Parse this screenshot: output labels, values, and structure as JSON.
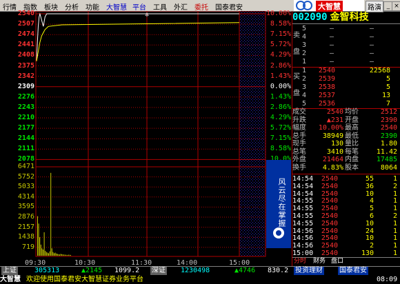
{
  "menu": {
    "items": [
      "行情",
      "指数",
      "板块",
      "分析",
      "功能",
      "大智慧",
      "平台",
      "工具",
      "外汇",
      "委托",
      "国泰君安"
    ],
    "right_button": "路演",
    "logo_text": "大智慧"
  },
  "stock": {
    "code": "002090",
    "name": "金智科技"
  },
  "price_axis": {
    "labels": [
      "2540",
      "2507",
      "2474",
      "2441",
      "2408",
      "2375",
      "2342",
      "2309",
      "2276",
      "2243",
      "2210",
      "2177",
      "2144",
      "2111",
      "2078"
    ],
    "percents": [
      "10.00%",
      "8.58%",
      "7.15%",
      "5.72%",
      "4.29%",
      "2.86%",
      "1.43%",
      "0.00%",
      "1.43%",
      "2.86%",
      "4.29%",
      "5.72%",
      "7.15%",
      "8.58%",
      "10.0%"
    ]
  },
  "volume_axis": {
    "labels": [
      "6471",
      "5752",
      "5033",
      "4314",
      "3595",
      "2876",
      "2157",
      "1438",
      "719"
    ]
  },
  "time_axis": {
    "labels": [
      "09:30",
      "10:30",
      "11:30",
      "14:00",
      "15:00"
    ]
  },
  "side_banner": "风云尽在掌握",
  "order_book": {
    "sell_label": [
      "卖",
      "盘"
    ],
    "buy_label": [
      "买",
      "盘"
    ],
    "sells": [
      {
        "level": "5",
        "price": "—",
        "vol": "—"
      },
      {
        "level": "4",
        "price": "—",
        "vol": "—"
      },
      {
        "level": "3",
        "price": "—",
        "vol": "—"
      },
      {
        "level": "2",
        "price": "—",
        "vol": "—"
      },
      {
        "level": "1",
        "price": "—",
        "vol": "—"
      }
    ],
    "buys": [
      {
        "level": "1",
        "price": "2540",
        "vol": "22568"
      },
      {
        "level": "2",
        "price": "2539",
        "vol": "5"
      },
      {
        "level": "3",
        "price": "2538",
        "vol": "5"
      },
      {
        "level": "4",
        "price": "2537",
        "vol": "13"
      },
      {
        "level": "5",
        "price": "2536",
        "vol": "7"
      }
    ]
  },
  "stats": [
    {
      "l1": "成交",
      "v1": "2540",
      "l2": "均价",
      "v2": "2512"
    },
    {
      "l1": "升跌",
      "v1": "▲231",
      "l2": "开盘",
      "v2": "2390"
    },
    {
      "l1": "幅度",
      "v1": "10.00%",
      "l2": "最高",
      "v2": "2540"
    },
    {
      "l1": "总手",
      "v1": "38949",
      "l2": "最低",
      "v2": "2390"
    },
    {
      "l1": "现手",
      "v1": "130",
      "l2": "量比",
      "v2": "1.80"
    },
    {
      "l1": "总笔",
      "v1": "3410",
      "l2": "每笔",
      "v2": "11.42"
    },
    {
      "l1": "外盘",
      "v1": "21464",
      "l2": "内盘",
      "v2": "17485"
    },
    {
      "l1": "换手",
      "v1": "4.83%",
      "l2": "股本",
      "v2": "8064"
    }
  ],
  "ticks": [
    {
      "time": "14:54",
      "price": "2540",
      "vol": "55",
      "cnt": "1"
    },
    {
      "time": "14:54",
      "price": "2540",
      "vol": "36",
      "cnt": "2"
    },
    {
      "time": "14:54",
      "price": "2540",
      "vol": "10",
      "cnt": "1"
    },
    {
      "time": "14:55",
      "price": "2540",
      "vol": "4",
      "cnt": "1"
    },
    {
      "time": "14:55",
      "price": "2540",
      "vol": "5",
      "cnt": "1"
    },
    {
      "time": "14:55",
      "price": "2540",
      "vol": "6",
      "cnt": "2"
    },
    {
      "time": "14:55",
      "price": "2540",
      "vol": "10",
      "cnt": "1"
    },
    {
      "time": "14:56",
      "price": "2540",
      "vol": "24",
      "cnt": "1"
    },
    {
      "time": "14:56",
      "price": "2540",
      "vol": "10",
      "cnt": "1"
    },
    {
      "time": "14:56",
      "price": "2540",
      "vol": "2",
      "cnt": "1"
    },
    {
      "time": "15:00",
      "price": "2540",
      "vol": "130",
      "cnt": "1"
    }
  ],
  "tabs": [
    "分时",
    "财务",
    "盘口"
  ],
  "bottom": {
    "sh_label": "上证",
    "sh_vol": "305313",
    "sh_chg": "▲2145",
    "sh_idx": "1099.2",
    "sz_label": "深证",
    "sz_vol": "1230498",
    "sz_chg": "▲4746",
    "sz_idx": "830.2",
    "promo1": "投资理财",
    "promo2": "国泰君安"
  },
  "ticker": {
    "brand": "大智慧",
    "text": "欢迎使用国泰君安大智慧证券业务平台",
    "clock": "08:09"
  },
  "colors": {
    "up": "#ff3232",
    "down": "#00e600",
    "grid": "#b00000",
    "price_line": "#ffffff",
    "avg_line": "#ffff00"
  }
}
